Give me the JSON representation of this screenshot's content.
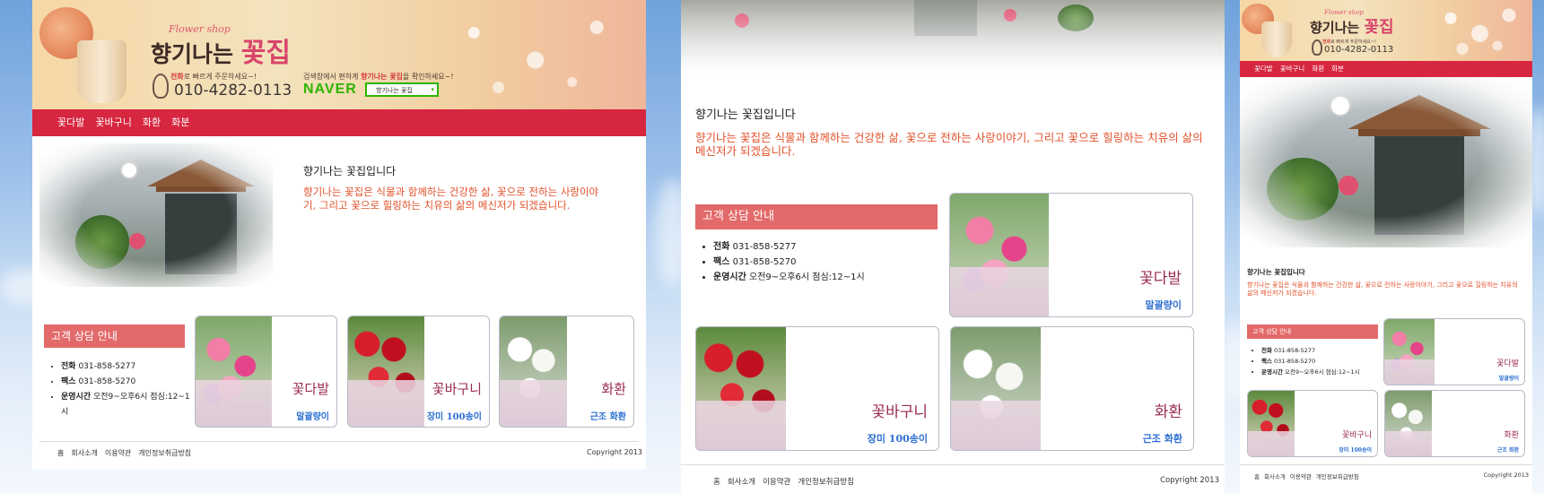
{
  "header": {
    "shop_small": "Flower shop",
    "shop_name_a": "향기나는",
    "shop_name_b": "꽃집",
    "phone_note_em": "전화",
    "phone_note_rest": "로 빠르게 주문하세요~!",
    "phone": "010-4282-0113",
    "search_note_a": "검색창에서 편하게 ",
    "search_note_em": "향기나는 꽃집",
    "search_note_b": "을 확인하세요~!",
    "naver_logo": "NAVER",
    "naver_search_value": "향기나는 꽃집"
  },
  "nav": {
    "items": [
      {
        "label": "꽃다발"
      },
      {
        "label": "꽃바구니"
      },
      {
        "label": "화환"
      },
      {
        "label": "화분"
      }
    ]
  },
  "intro": {
    "title": "향기나는 꽃집입니다",
    "text": "향기나는 꽃집은 식물과 함께하는 건강한 삶, 꽃으로 전하는 사랑이야기, 그리고 꽃으로 힐링하는 치유의 삶의 메신저가 되겠습니다."
  },
  "consult": {
    "title": "고객 상담 안내",
    "items": [
      {
        "label": "전화",
        "value": "031-858-5277"
      },
      {
        "label": "팩스",
        "value": "031-858-5270"
      },
      {
        "label": "운영시간",
        "value": "오전9~오후6시 점심:12~1시"
      }
    ]
  },
  "products": [
    {
      "name": "꽃다발",
      "sub": "말괄량이"
    },
    {
      "name": "꽃바구니",
      "sub": "장미 100송이"
    },
    {
      "name": "화환",
      "sub": "근조 화환"
    }
  ],
  "footer": {
    "links": [
      {
        "label": "홈"
      },
      {
        "label": "회사소개"
      },
      {
        "label": "이용약관"
      },
      {
        "label": "개인정보취급방침"
      }
    ],
    "copyright": "Copyright 2013"
  },
  "colors": {
    "nav_red": "#d7263f",
    "consult_head": "#e36a6a",
    "intro_text": "#e2502a",
    "product_name": "#9b2d55",
    "product_sub": "#2d6fd0",
    "naver_green": "#2db400"
  }
}
